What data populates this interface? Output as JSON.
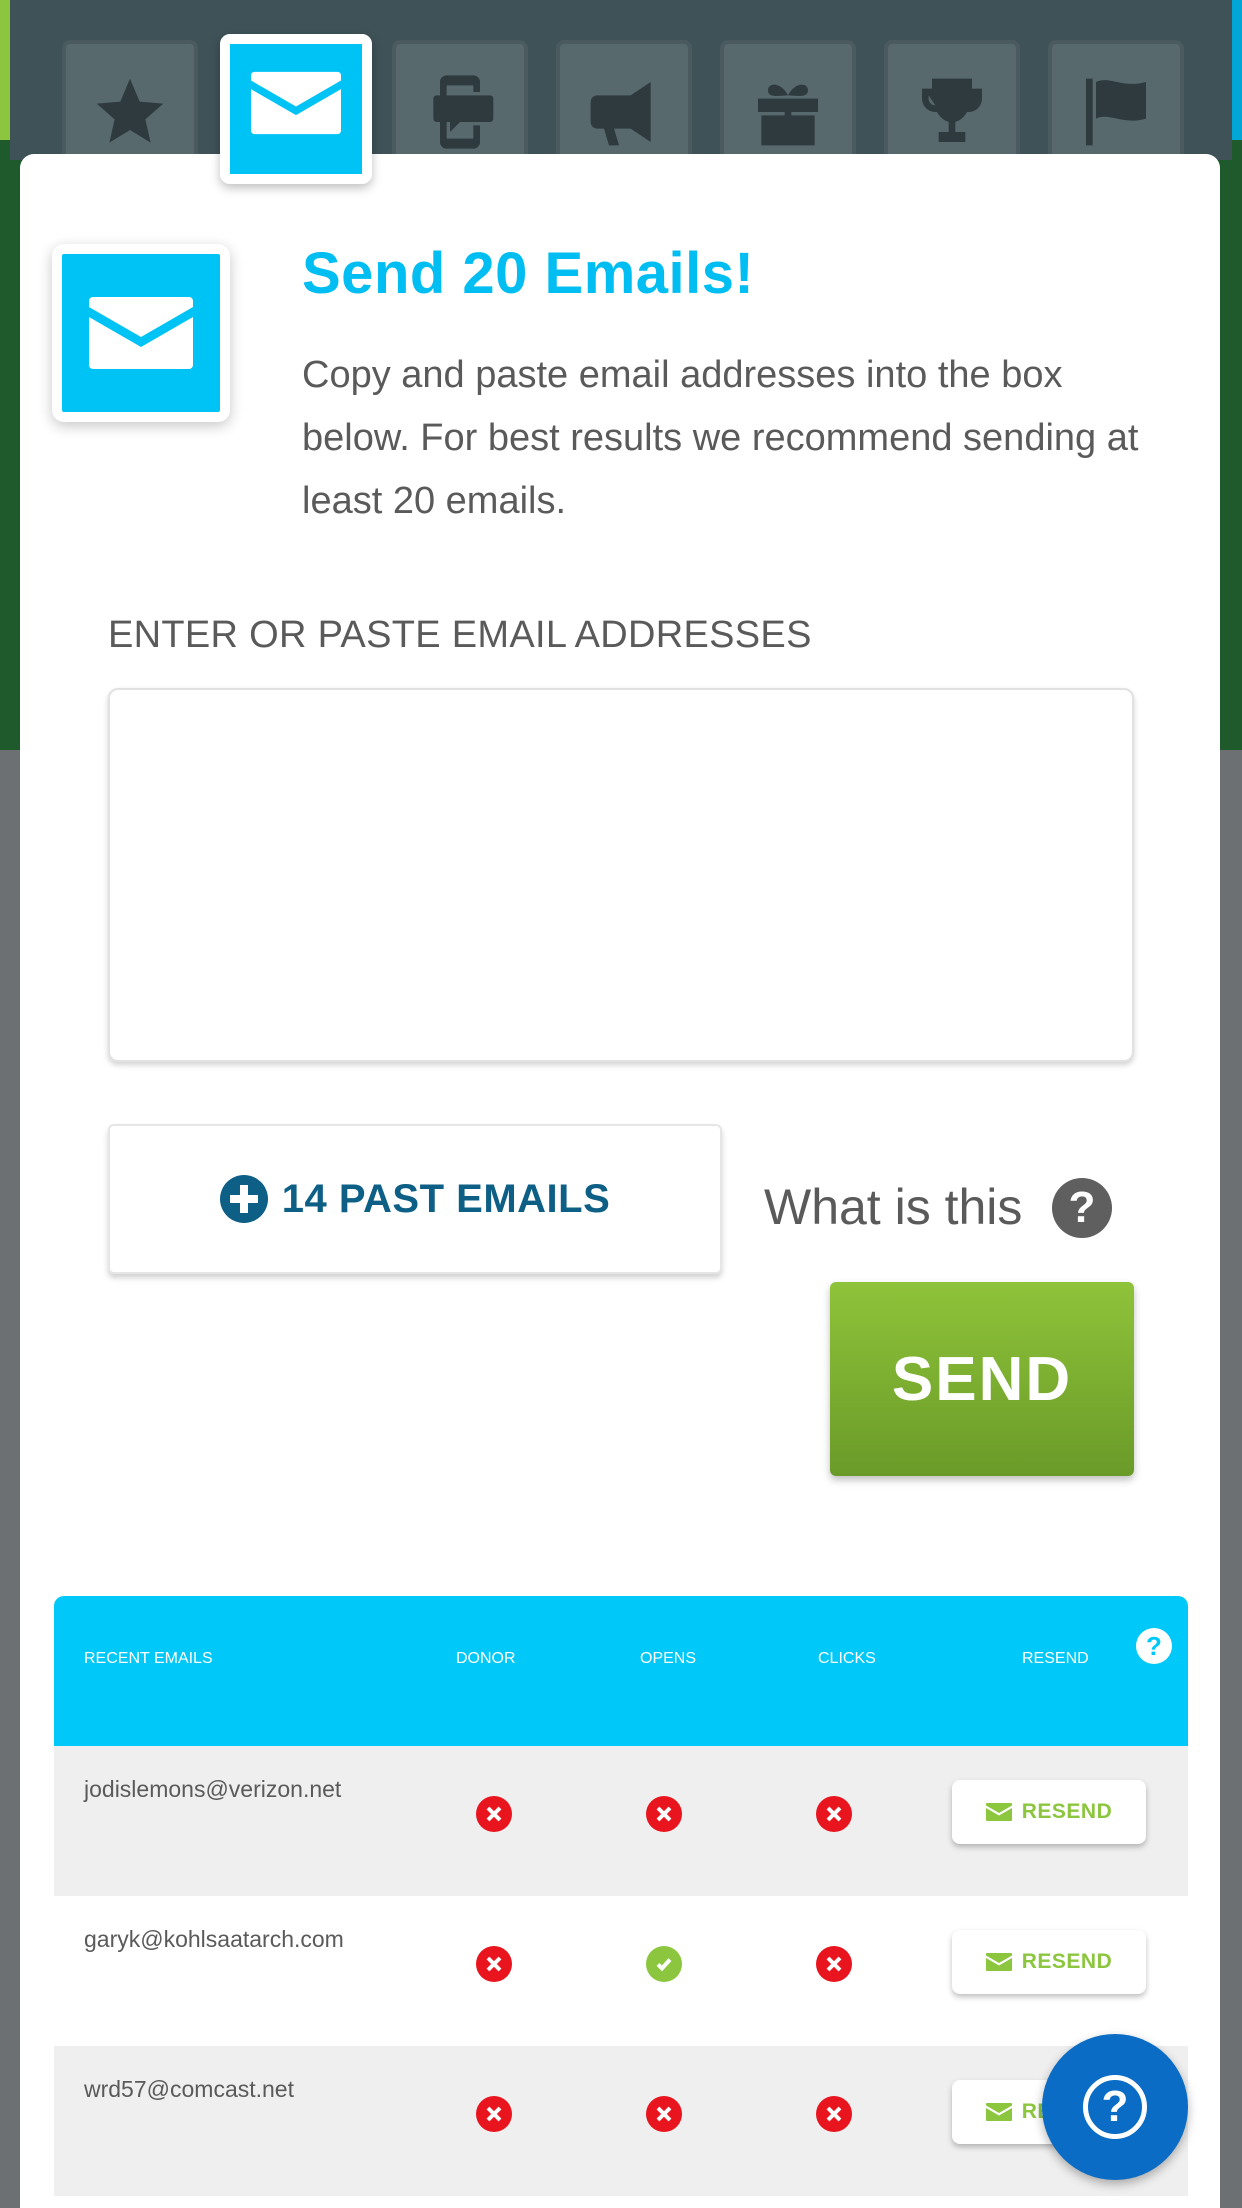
{
  "tabs": [
    {
      "icon": "star-icon"
    },
    {
      "icon": "envelope-icon",
      "active": true
    },
    {
      "icon": "phone-message-icon"
    },
    {
      "icon": "megaphone-icon"
    },
    {
      "icon": "gift-icon"
    },
    {
      "icon": "trophy-icon"
    },
    {
      "icon": "flag-icon"
    }
  ],
  "header": {
    "title": "Send 20 Emails!",
    "subtitle": "Copy and paste email addresses into the box below. For best results we recommend sending at least 20 emails.",
    "hero_icon": "envelope-icon"
  },
  "form": {
    "label": "ENTER OR PASTE EMAIL ADDRESSES",
    "value": "",
    "past_emails_label": "14 PAST EMAILS",
    "what_is_this": "What is this",
    "help_glyph": "?",
    "send_label": "SEND"
  },
  "table": {
    "headers": {
      "recent": "RECENT EMAILS",
      "donor": "DONOR",
      "opens": "OPENS",
      "clicks": "CLICKS",
      "resend": "RESEND"
    },
    "help_glyph": "?",
    "rows": [
      {
        "email": "jodislemons@verizon.net",
        "donor": false,
        "opens": false,
        "clicks": false,
        "resend_label": "RESEND"
      },
      {
        "email": "garyk@kohlsaatarch.com",
        "donor": false,
        "opens": true,
        "clicks": false,
        "resend_label": "RESEND"
      },
      {
        "email": "wrd57@comcast.net",
        "donor": false,
        "opens": false,
        "clicks": false,
        "resend_label": "RESEND"
      }
    ]
  },
  "fab": {
    "glyph": "?"
  },
  "colors": {
    "accent": "#00c3f5",
    "send_green": "#8cc63f",
    "dark_blue": "#0d5f86",
    "error_red": "#e8141e"
  }
}
